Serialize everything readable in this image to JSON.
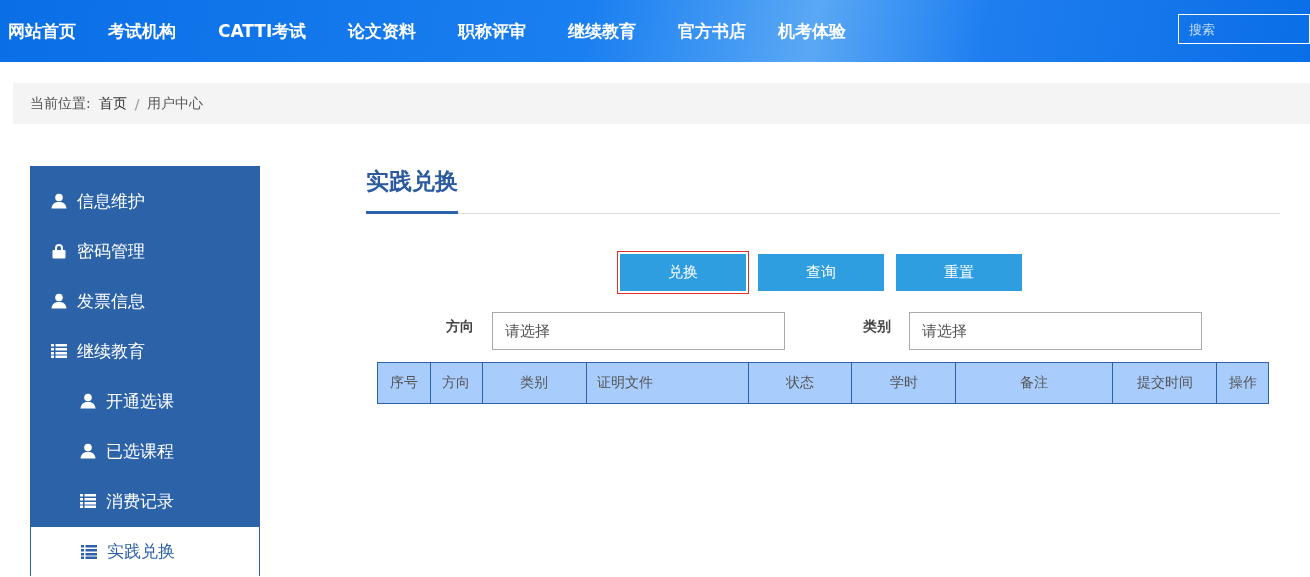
{
  "nav": {
    "items": [
      "网站首页",
      "考试机构",
      "CATTI考试",
      "论文资料",
      "职称评审",
      "继续教育",
      "官方书店",
      "机考体验"
    ],
    "search": {
      "placeholder": "搜索"
    }
  },
  "breadcrumb": {
    "label": "当前位置:",
    "separator": "/",
    "items": [
      "首页",
      "用户中心"
    ]
  },
  "sidebar": {
    "items": [
      {
        "label": "信息维护",
        "kind": "user",
        "selected": false
      },
      {
        "label": "密码管理",
        "kind": "lock",
        "selected": false
      },
      {
        "label": "发票信息",
        "kind": "user",
        "selected": false
      },
      {
        "label": "继续教育",
        "kind": "list",
        "selected": false,
        "children": [
          {
            "label": "开通选课",
            "kind": "user",
            "selected": false
          },
          {
            "label": "已选课程",
            "kind": "user",
            "selected": false
          },
          {
            "label": "消费记录",
            "kind": "list",
            "selected": false
          },
          {
            "label": "实践兑换",
            "kind": "list",
            "selected": true
          }
        ]
      }
    ]
  },
  "main": {
    "title": "实践兑换",
    "buttons": [
      {
        "label": "兑换",
        "focused": true
      },
      {
        "label": "查询",
        "focused": false
      },
      {
        "label": "重置",
        "focused": false
      }
    ],
    "filters": [
      {
        "label": "方向",
        "placeholder": "请选择"
      },
      {
        "label": "类别",
        "placeholder": "请选择"
      }
    ],
    "table": {
      "columns": [
        "序号",
        "方向",
        "类别",
        "证明文件",
        "状态",
        "学时",
        "备注",
        "提交时间",
        "操作"
      ]
    }
  }
}
